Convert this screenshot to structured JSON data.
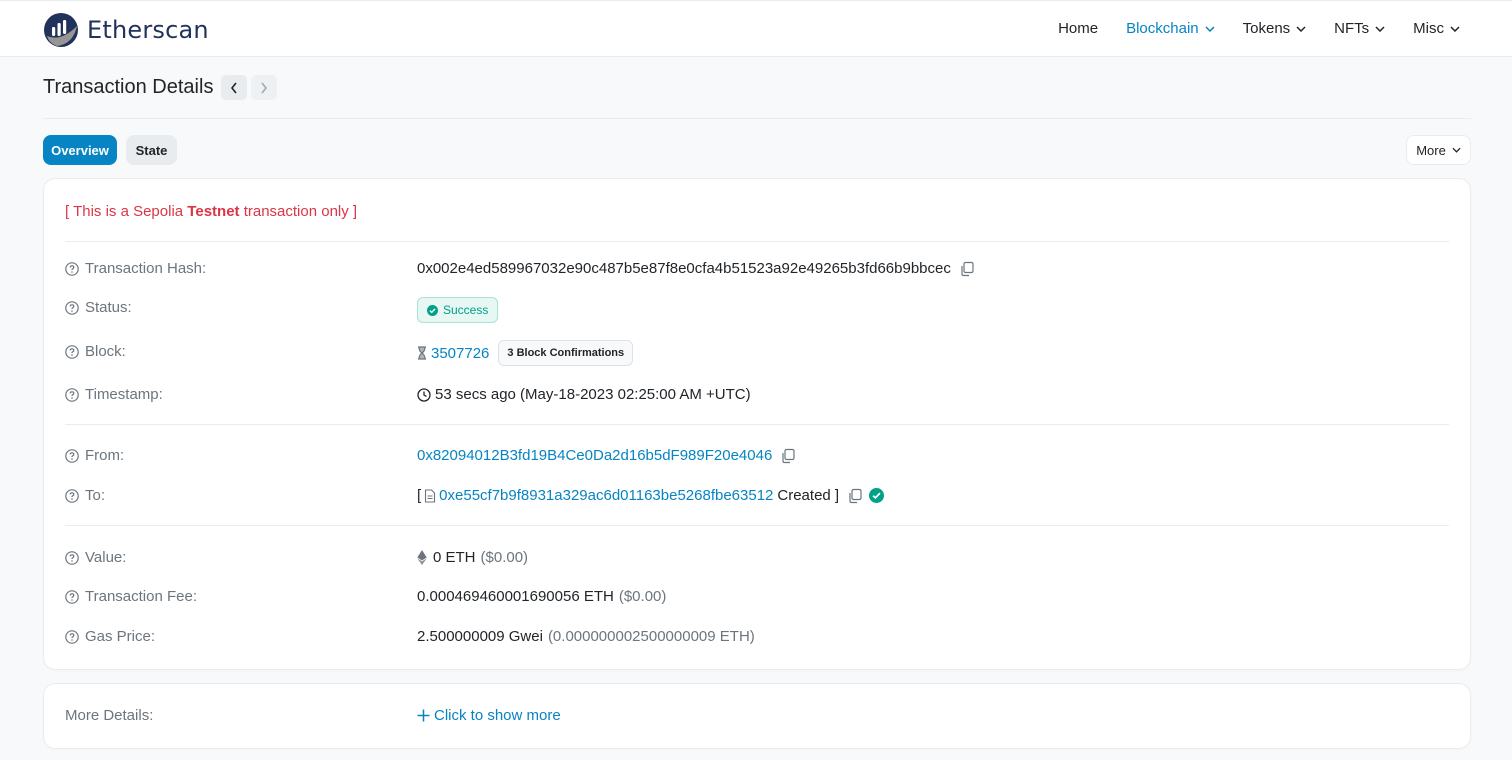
{
  "brand": {
    "name": "Etherscan"
  },
  "nav": {
    "items": [
      {
        "label": "Home",
        "active": false
      },
      {
        "label": "Blockchain",
        "active": true
      },
      {
        "label": "Tokens",
        "active": false
      },
      {
        "label": "NFTs",
        "active": false
      },
      {
        "label": "Misc",
        "active": false
      }
    ]
  },
  "page": {
    "title": "Transaction Details"
  },
  "tabs": {
    "overview": "Overview",
    "state": "State",
    "more": "More"
  },
  "notice": {
    "prefix": "[ This is a Sepolia ",
    "bold": "Testnet",
    "suffix": " transaction only ]"
  },
  "fields": {
    "hash": {
      "label": "Transaction Hash:",
      "value": "0x002e4ed589967032e90c487b5e87f8e0cfa4b51523a92e49265b3fd66b9bbcec"
    },
    "status": {
      "label": "Status:",
      "value": "Success"
    },
    "block": {
      "label": "Block:",
      "value": "3507726",
      "confirmations": "3 Block Confirmations"
    },
    "timestamp": {
      "label": "Timestamp:",
      "value": "53 secs ago (May-18-2023 02:25:00 AM +UTC)"
    },
    "from": {
      "label": "From:",
      "value": "0x82094012B3fd19B4Ce0Da2d16b5dF989F20e4046"
    },
    "to": {
      "label": "To:",
      "open": "[",
      "address": "0xe55cf7b9f8931a329ac6d01163be5268fbe63512",
      "suffix": "Created ]"
    },
    "value": {
      "label": "Value:",
      "amount": "0 ETH",
      "usd": "($0.00)"
    },
    "fee": {
      "label": "Transaction Fee:",
      "amount": "0.000469460001690056 ETH",
      "usd": "($0.00)"
    },
    "gas": {
      "label": "Gas Price:",
      "amount": "2.500000009 Gwei",
      "eth": "(0.000000002500000009 ETH)"
    }
  },
  "more_details": {
    "label": "More Details:",
    "action": "Click to show more"
  },
  "colors": {
    "accent": "#0784c3",
    "success": "#00a186",
    "danger": "#dc3545",
    "muted": "#6c757d"
  }
}
